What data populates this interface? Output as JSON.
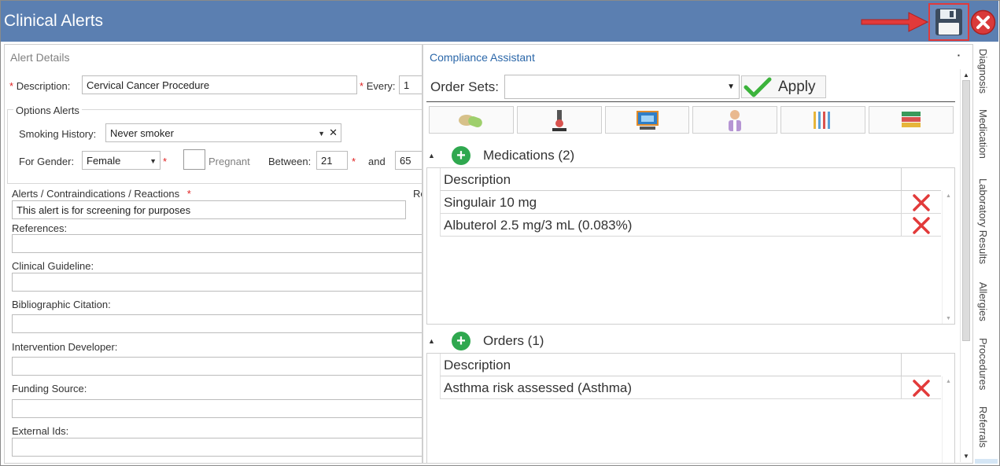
{
  "window": {
    "title": "Clinical Alerts"
  },
  "alert_details": {
    "section_title": "Alert Details",
    "description_label": "Description:",
    "description_value": "Cervical Cancer Procedure",
    "every_label": "Every:",
    "every_value": "1",
    "options_title": "Options Alerts",
    "smoking_label": "Smoking History:",
    "smoking_value": "Never smoker",
    "gender_label": "For Gender:",
    "gender_value": "Female",
    "pregnant_label": "Pregnant",
    "between_label": "Between:",
    "between_from": "21",
    "and_label": "and",
    "between_to": "65",
    "alerts_label": "Alerts / Contraindications / Reactions",
    "alerts_value": "This alert is for screening for purposes",
    "re_label": "Re",
    "references_label": "References:",
    "guideline_label": "Clinical Guideline:",
    "citation_label": "Bibliographic Citation:",
    "developer_label": "Intervention Developer:",
    "funding_label": "Funding Source:",
    "external_label": "External Ids:",
    "required_mark": "*"
  },
  "compliance": {
    "title": "Compliance Assistant",
    "order_sets_label": "Order Sets:",
    "order_sets_value": "",
    "apply_label": "Apply",
    "tool_icons": [
      "medication-icon",
      "laboratory-icon",
      "computer-icon",
      "doctor-icon",
      "instruments-icon",
      "books-icon"
    ],
    "medications": {
      "title": "Medications (2)",
      "column": "Description",
      "rows": [
        "Singulair 10 mg",
        "Albuterol 2.5 mg/3 mL (0.083%)"
      ]
    },
    "orders": {
      "title": "Orders (1)",
      "column": "Description",
      "rows": [
        "Asthma risk assessed (Asthma)"
      ]
    }
  },
  "side_tabs": [
    "Diagnosis",
    "Medication",
    "Laboratory Results",
    "Allergies",
    "Procedures",
    "Referrals"
  ],
  "colors": {
    "titlebar": "#5b7fb1",
    "accent_link": "#2b67a9",
    "add_green": "#2fa84f",
    "delete_red": "#e23a3a"
  }
}
